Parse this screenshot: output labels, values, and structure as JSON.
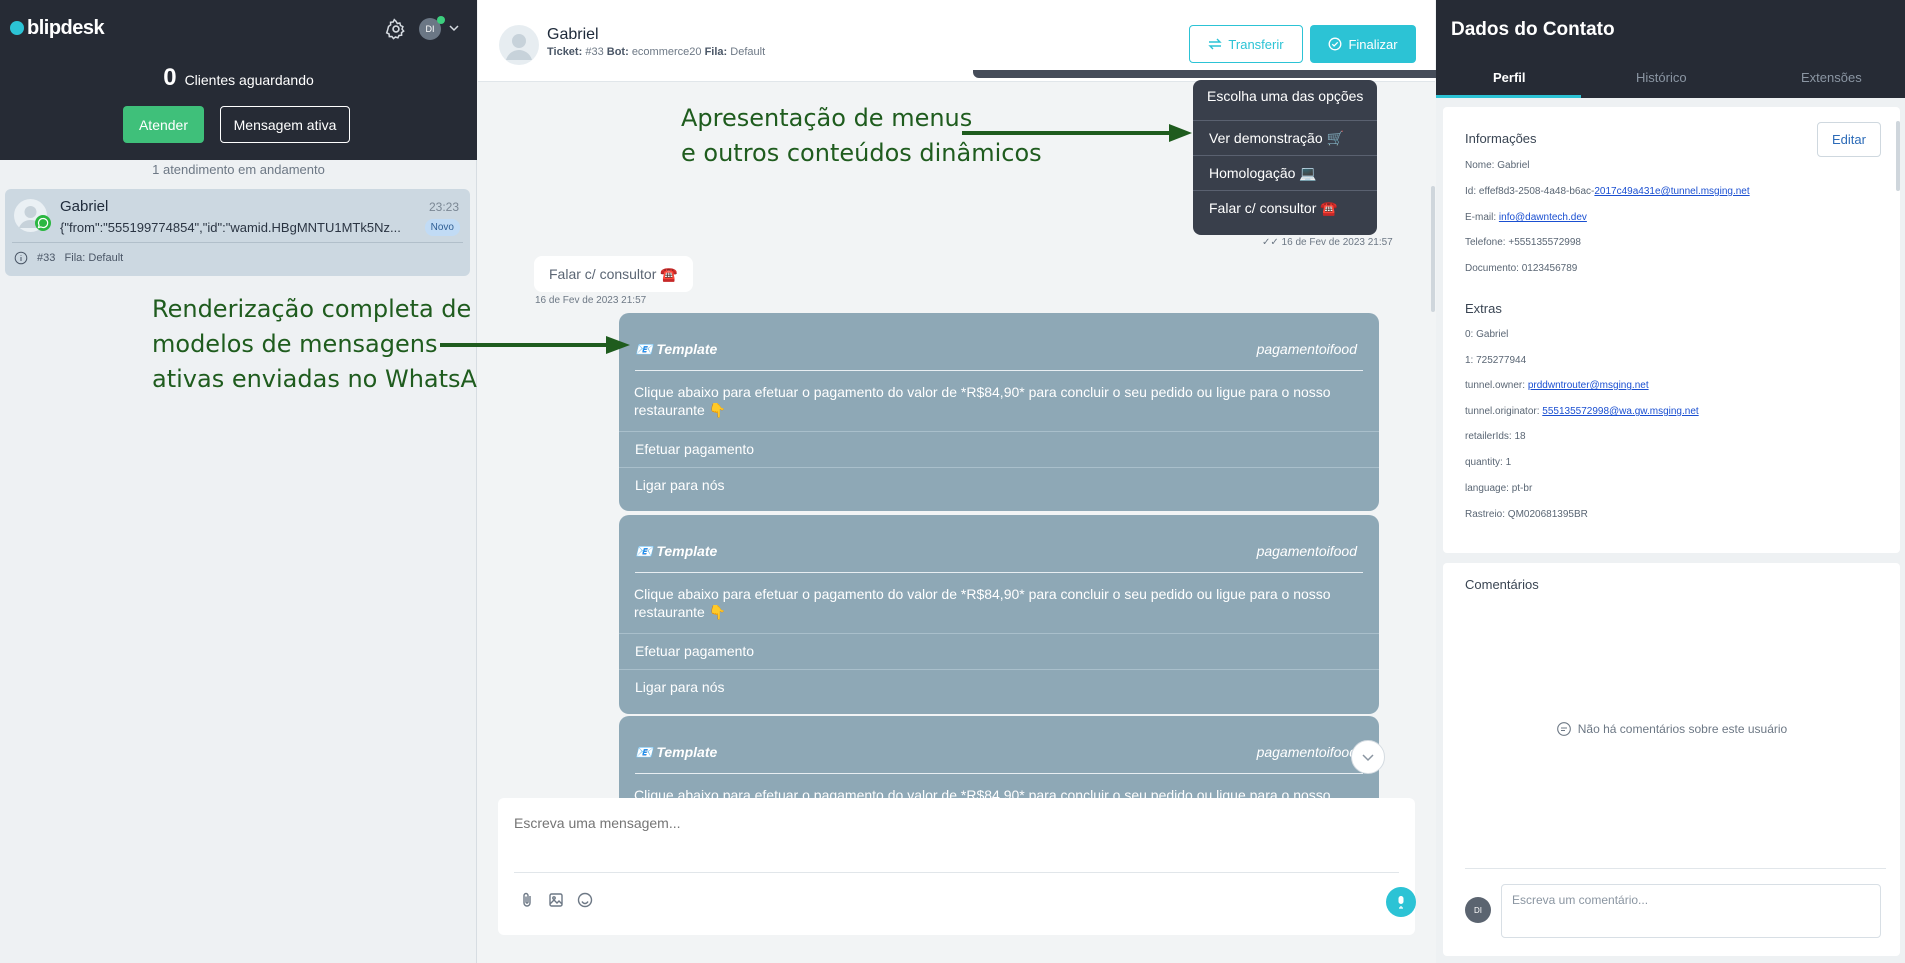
{
  "brand": {
    "logo_text": "blipdesk",
    "user_initials": "DI"
  },
  "queue": {
    "waiting_count": "0",
    "waiting_label": "Clientes aguardando",
    "attend_label": "Atender",
    "active_message_label": "Mensagem ativa",
    "in_progress_label": "1 atendimento em andamento"
  },
  "conversation_list": [
    {
      "name": "Gabriel",
      "time": "23:23",
      "preview": "{\"from\":\"555199774854\",\"id\":\"wamid.HBgMNTU1MTk5Nz...",
      "badge": "Novo",
      "ticket": "#33",
      "queue_label": "Fila:",
      "queue_value": "Default"
    }
  ],
  "annotations": {
    "menus_line1": "Apresentação de menus",
    "menus_line2": "e outros conteúdos dinâmicos",
    "templates_line1": "Renderização completa de",
    "templates_line2": "modelos de mensagens",
    "templates_line3": "ativas enviadas no WhatsApp"
  },
  "chat": {
    "contact_name": "Gabriel",
    "ticket_label": "Ticket:",
    "ticket_value": "#33",
    "bot_label": "Bot:",
    "bot_value": "ecommerce20",
    "queue_label": "Fila:",
    "queue_value": "Default",
    "transfer_label": "Transferir",
    "finish_label": "Finalizar",
    "menu": {
      "title": "Escolha uma das opções",
      "items": [
        "Ver demonstração 🛒",
        "Homologação 💻",
        "Falar c/ consultor ☎️"
      ],
      "timestamp": "16 de Fev de 2023 21:57"
    },
    "incoming": {
      "text": "Falar c/ consultor ☎️",
      "timestamp": "16 de Fev de 2023 21:57"
    },
    "template": {
      "label": "Template",
      "name": "pagamentoifood",
      "body": "Clique abaixo para efetuar o pagamento do valor de *R$84,90* para concluir o seu pedido ou ligue para o nosso restaurante 👇",
      "buttons": [
        "Efetuar pagamento",
        "Ligar para nós"
      ]
    },
    "composer_placeholder": "Escreva uma mensagem..."
  },
  "contact_panel": {
    "title": "Dados do Contato",
    "tabs": [
      "Perfil",
      "Histórico",
      "Extensões"
    ],
    "info_title": "Informações",
    "edit_label": "Editar",
    "fields": {
      "nome_label": "Nome:",
      "nome_value": "Gabriel",
      "id_label": "Id:",
      "id_plain": "effef8d3-2508-4a48-b6ac-",
      "id_link": "2017c49a431e@tunnel.msging.net",
      "email_label": "E-mail:",
      "email_value": "info@dawntech.dev",
      "telefone_label": "Telefone:",
      "telefone_value": "+555135572998",
      "documento_label": "Documento:",
      "documento_value": "0123456789"
    },
    "extras_title": "Extras",
    "extras": {
      "e0_label": "0:",
      "e0_value": "Gabriel",
      "e1_label": "1:",
      "e1_value": "725277944",
      "owner_label": "tunnel.owner:",
      "owner_value": "prddwntrouter@msging.net",
      "originator_label": "tunnel.originator:",
      "originator_value": "555135572998@wa.gw.msging.net",
      "retailer_label": "retailerIds:",
      "retailer_value": "18",
      "quantity_label": "quantity:",
      "quantity_value": "1",
      "language_label": "language:",
      "language_value": "pt-br",
      "rastreio_label": "Rastreio:",
      "rastreio_value": "QM020681395BR"
    },
    "comments_title": "Comentários",
    "no_comments": "Não há comentários sobre este usuário",
    "comment_placeholder": "Escreva um comentário..."
  },
  "colors": {
    "accent": "#2cc3d5",
    "dark": "#262b35",
    "success": "#3fc07a",
    "template_bg": "#8ea8b6",
    "annotation": "#1f5c1e"
  }
}
